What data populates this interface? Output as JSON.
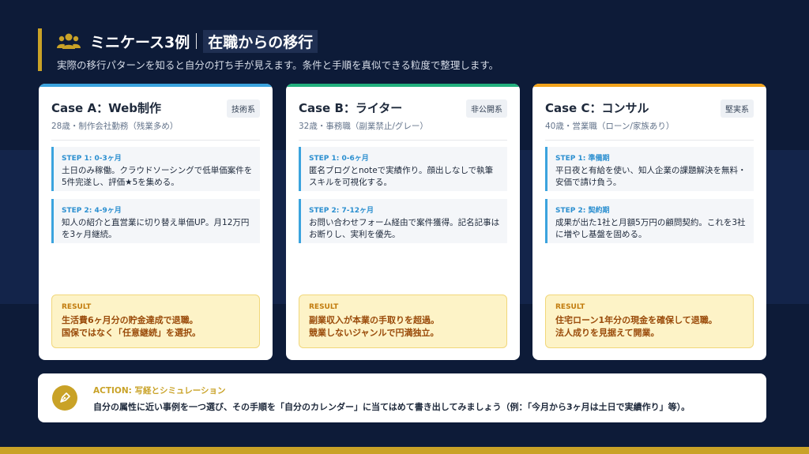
{
  "header": {
    "title": "ミニケース3例",
    "title_sub": "在職からの移行",
    "subtitle": "実際の移行パターンを知ると自分の打ち手が見えます。条件と手順を真似できる粒度で整理します。",
    "accent_color": "#c9a227",
    "icon": "users-icon"
  },
  "cases": [
    {
      "title": "Case A：Web制作",
      "tag": "技術系",
      "meta": "28歳・制作会社勤務（残業多め）",
      "top_color": "#3ba3de",
      "steps": [
        {
          "label": "STEP 1: 0-3ヶ月",
          "text": "土日のみ稼働。クラウドソーシングで低単価案件を5件完遂し、評価★5を集める。"
        },
        {
          "label": "STEP 2: 4-9ヶ月",
          "text": "知人の紹介と直営業に切り替え単価UP。月12万円を3ヶ月継続。"
        }
      ],
      "result_label": "RESULT",
      "result_lines": [
        "生活費6ヶ月分の貯金達成で退職。",
        "国保ではなく「任意継続」を選択。"
      ]
    },
    {
      "title": "Case B：ライター",
      "tag": "非公開系",
      "meta": "32歳・事務職（副業禁止/グレー）",
      "top_color": "#22b07d",
      "steps": [
        {
          "label": "STEP 1: 0-6ヶ月",
          "text": "匿名ブログとnoteで実績作り。顔出しなしで執筆スキルを可視化する。"
        },
        {
          "label": "STEP 2: 7-12ヶ月",
          "text": "お問い合わせフォーム経由で案件獲得。記名記事はお断りし、実利を優先。"
        }
      ],
      "result_label": "RESULT",
      "result_lines": [
        "副業収入が本業の手取りを超過。",
        "競業しないジャンルで円満独立。"
      ]
    },
    {
      "title": "Case C：コンサル",
      "tag": "堅実系",
      "meta": "40歳・営業職（ローン/家族あり）",
      "top_color": "#f2a31b",
      "steps": [
        {
          "label": "STEP 1: 準備期",
          "text": "平日夜と有給を使い、知人企業の課題解決を無料・安価で請け負う。"
        },
        {
          "label": "STEP 2: 契約期",
          "text": "成果が出た1社と月額5万円の顧問契約。これを3社に増やし基盤を固める。"
        }
      ],
      "result_label": "RESULT",
      "result_lines": [
        "住宅ローン1年分の現金を確保して退職。",
        "法人成りを見据えて開業。"
      ]
    }
  ],
  "action": {
    "label": "ACTION: 写経とシミュレーション",
    "text": "自分の属性に近い事例を一つ選び、その手順を「自分のカレンダー」に当てはめて書き出してみましょう（例：「今月から3ヶ月は土日で実績作り」等）。",
    "icon": "pen-nib-icon"
  }
}
